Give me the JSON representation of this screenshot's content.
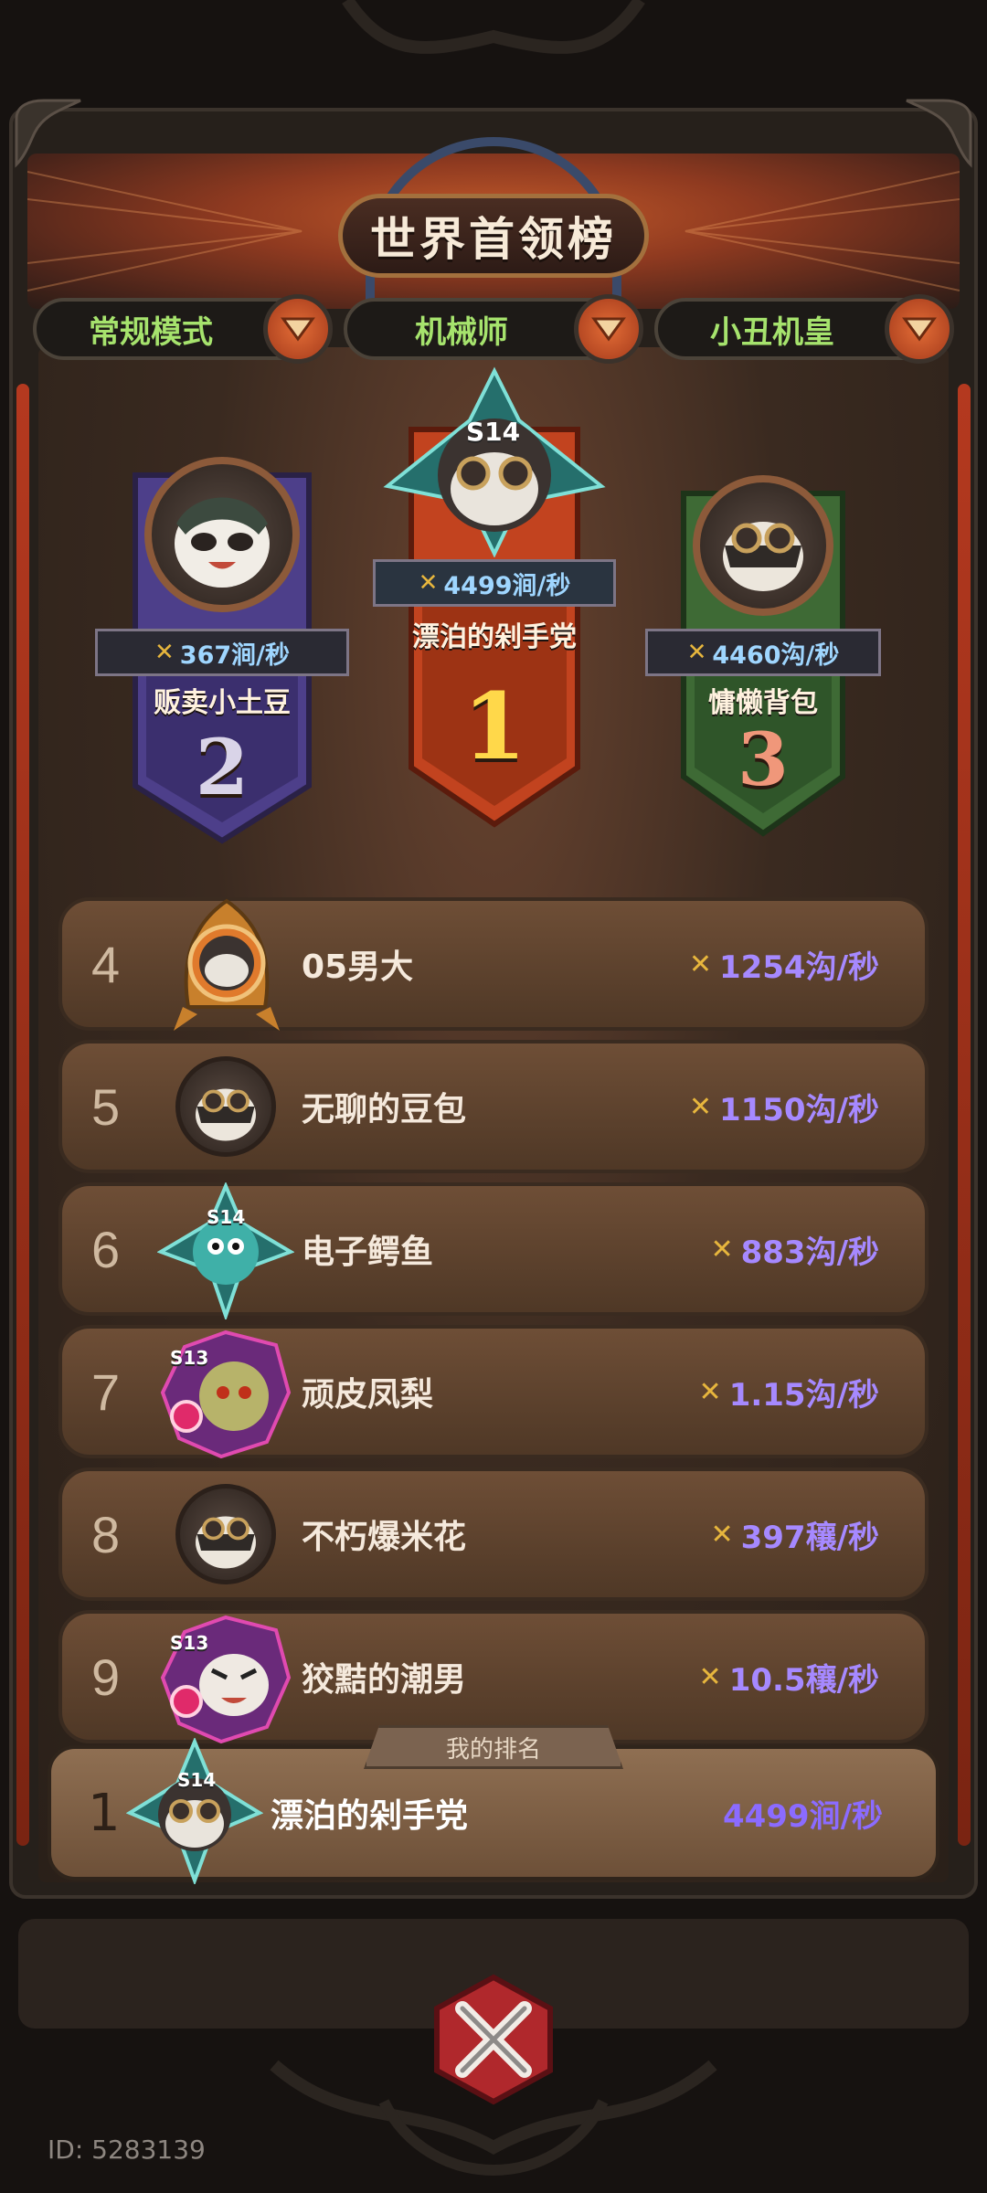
{
  "header": {
    "title": "世界首领榜"
  },
  "filters": [
    {
      "label": "常规模式"
    },
    {
      "label": "机械师"
    },
    {
      "label": "小丑机皇"
    }
  ],
  "podium": {
    "first": {
      "rank": "1",
      "name": "漂泊的剁手党",
      "score": "4499涧/秒",
      "season": "S14"
    },
    "second": {
      "rank": "2",
      "name": "贩卖小土豆",
      "score": "367涧/秒"
    },
    "third": {
      "rank": "3",
      "name": "慵懒背包",
      "score": "4460沟/秒"
    }
  },
  "list": [
    {
      "rank": "4",
      "name": "05男大",
      "score": "1254沟/秒"
    },
    {
      "rank": "5",
      "name": "无聊的豆包",
      "score": "1150沟/秒"
    },
    {
      "rank": "6",
      "name": "电子鳄鱼",
      "score": "883沟/秒",
      "season": "S14"
    },
    {
      "rank": "7",
      "name": "顽皮凤梨",
      "score": "1.15沟/秒",
      "season": "S13"
    },
    {
      "rank": "8",
      "name": "不朽爆米花",
      "score": "397穰/秒"
    },
    {
      "rank": "9",
      "name": "狡黠的潮男",
      "score": "10.5穰/秒",
      "season": "S13"
    }
  ],
  "my_rank": {
    "tag": "我的排名",
    "rank": "1",
    "name": "漂泊的剁手党",
    "score": "4499涧/秒",
    "season": "S14"
  },
  "footer": {
    "id": "ID: 5283139"
  },
  "colors": {
    "accent_green": "#a6e36d",
    "score_purple": "#a689ff",
    "rank_first": "#ffd84a",
    "rank_second": "#d9d4e8",
    "rank_third": "#f0977a"
  }
}
